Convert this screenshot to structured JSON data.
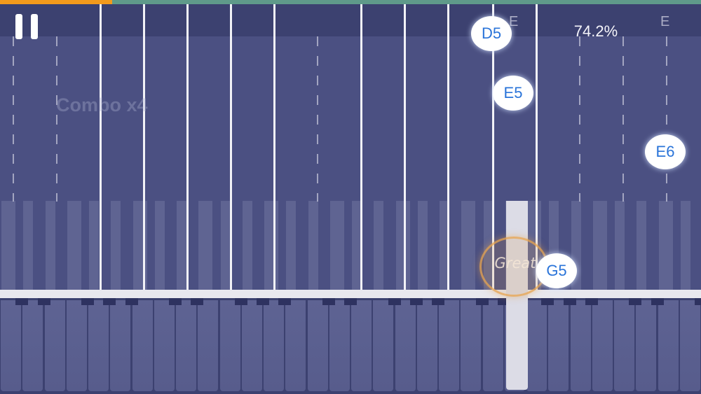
{
  "hud": {
    "progress": 0.16,
    "accuracy": "74.2%",
    "lane_letters": [
      "E",
      "E"
    ]
  },
  "combo": {
    "label": "Combo x4"
  },
  "notes": [
    "D5",
    "E5",
    "E6",
    "G5"
  ],
  "feedback": {
    "label": "Great"
  },
  "colors": {
    "progress_fill": "#f39a1c",
    "progress_track": "#5f9a8a",
    "background": "#4b5082",
    "note_text": "#2a74d9"
  }
}
